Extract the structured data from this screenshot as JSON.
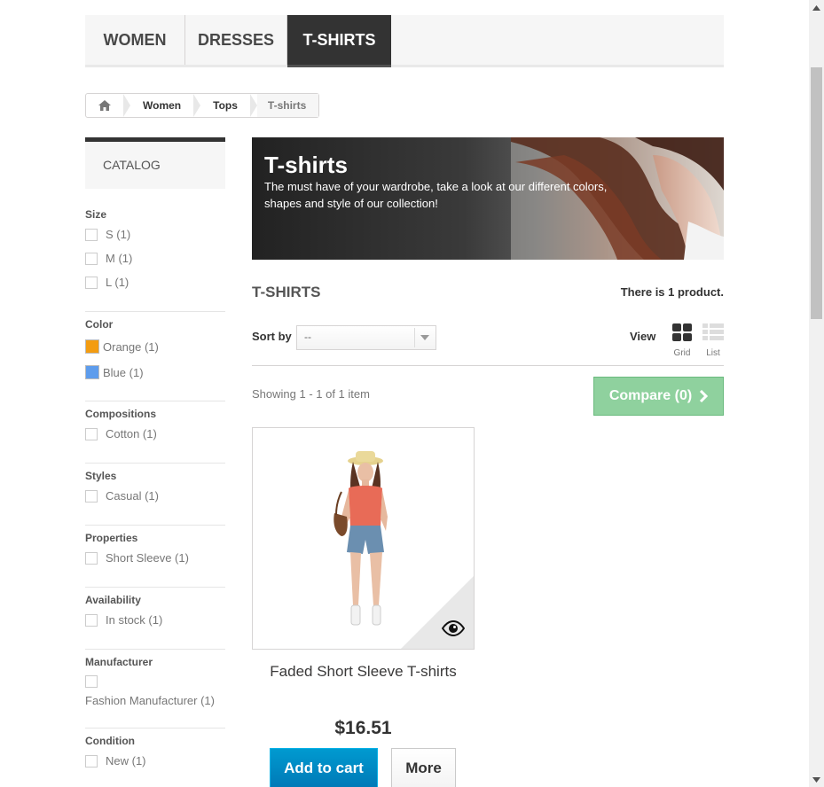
{
  "menu": {
    "items": [
      {
        "label": "WOMEN",
        "active": false
      },
      {
        "label": "DRESSES",
        "active": false
      },
      {
        "label": "T-SHIRTS",
        "active": true
      }
    ]
  },
  "breadcrumb": {
    "home_icon": "home-icon",
    "items": [
      "Women",
      "Tops"
    ],
    "current": "T-shirts"
  },
  "sidebar": {
    "title": "CATALOG",
    "filters": {
      "size": {
        "title": "Size",
        "options": [
          "S (1)",
          "M (1)",
          "L (1)"
        ]
      },
      "color": {
        "title": "Color",
        "options": [
          {
            "label": "Orange (1)",
            "swatch": "#f39c11"
          },
          {
            "label": "Blue (1)",
            "swatch": "#5d9cec"
          }
        ]
      },
      "compositions": {
        "title": "Compositions",
        "options": [
          "Cotton (1)"
        ]
      },
      "styles": {
        "title": "Styles",
        "options": [
          "Casual (1)"
        ]
      },
      "properties": {
        "title": "Properties",
        "options": [
          "Short Sleeve (1)"
        ]
      },
      "availability": {
        "title": "Availability",
        "options": [
          "In stock (1)"
        ]
      },
      "manufacturer": {
        "title": "Manufacturer",
        "options": [
          "Fashion Manufacturer (1)"
        ]
      },
      "condition": {
        "title": "Condition",
        "options": [
          "New (1)"
        ]
      }
    }
  },
  "banner": {
    "title": "T-shirts",
    "description": "The must have of your wardrobe, take a look at our different colors, shapes and style of our collection!"
  },
  "listing": {
    "heading": "T-SHIRTS",
    "count": "There is 1 product.",
    "sort_label": "Sort by",
    "sort_value": "--",
    "view_label": "View",
    "view_grid": "Grid",
    "view_list": "List",
    "showing": "Showing 1 - 1 of 1 item",
    "compare": "Compare (0)"
  },
  "product": {
    "name": "Faded Short Sleeve T-shirts",
    "price": "$16.51",
    "add_to_cart": "Add to cart",
    "more": "More"
  },
  "colors": {
    "menu_active": "#333333",
    "compare_green": "#8fd19e",
    "cart_blue": "#0091c9"
  }
}
